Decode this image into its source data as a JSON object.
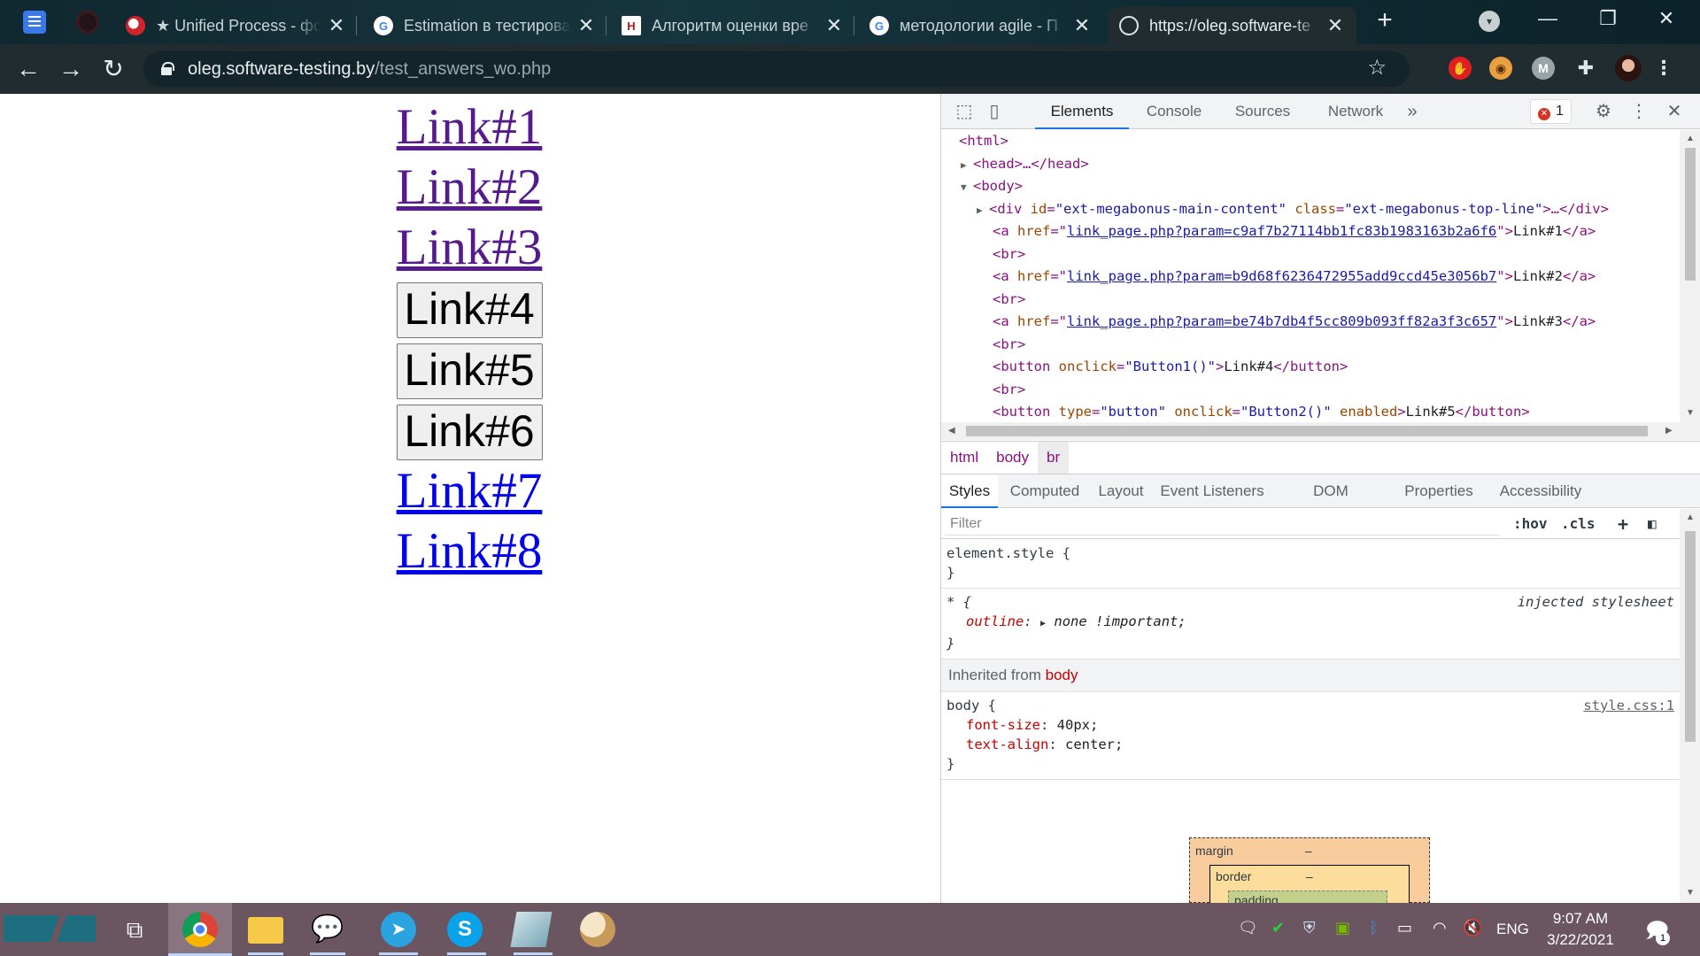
{
  "browser": {
    "tabs": [
      {
        "title": "",
        "active": false
      },
      {
        "title": "★ Unified Process - фо",
        "active": false
      },
      {
        "title": "Estimation в тестирова",
        "active": false
      },
      {
        "title": "Алгоритм оценки вре",
        "active": false
      },
      {
        "title": "методологии agile - П",
        "active": false
      },
      {
        "title": "https://oleg.software-te",
        "active": true
      }
    ],
    "url_host": "oleg.software-testing.by",
    "url_path": "/test_answers_wo.php",
    "profile_initial": "M"
  },
  "page": {
    "links": [
      {
        "label": "Link#1",
        "kind": "link",
        "visited": true
      },
      {
        "label": "Link#2",
        "kind": "link",
        "visited": true
      },
      {
        "label": "Link#3",
        "kind": "link",
        "visited": true
      },
      {
        "label": "Link#4",
        "kind": "button"
      },
      {
        "label": "Link#5",
        "kind": "button"
      },
      {
        "label": "Link#6",
        "kind": "button"
      },
      {
        "label": "Link#7",
        "kind": "link",
        "visited": false
      },
      {
        "label": "Link#8",
        "kind": "link",
        "visited": false
      }
    ]
  },
  "devtools": {
    "tabs": [
      "Elements",
      "Console",
      "Sources",
      "Network"
    ],
    "active_tab": "Elements",
    "error_count": "1",
    "dom": {
      "html_open": "<html>",
      "head": "<head>…</head>",
      "body_open": "<body>",
      "div_tag": "<div",
      "div_id_attr": "id",
      "div_id_val": "\"ext-megabonus-main-content\"",
      "div_class_attr": "class",
      "div_class_val": "\"ext-megabonus-top-line\"",
      "div_close": ">…</div>",
      "links": [
        {
          "href": "link_page.php?param=c9af7b27114bb1fc83b1983163b2a6f6",
          "text": "Link#1"
        },
        {
          "href": "link_page.php?param=b9d68f6236472955add9ccd45e3056b7",
          "text": "Link#2"
        },
        {
          "href": "link_page.php?param=be74b7db4f5cc809b093ff82a3f3c657",
          "text": "Link#3"
        }
      ],
      "br": "<br>",
      "button_onclick": "\"Button1()\"",
      "button_text": "Link#4",
      "button2_type": "\"button\"",
      "button2_onclick": "\"Button2()\"",
      "button2_extra": "enabled",
      "button2_text": "Link#5"
    },
    "breadcrumbs": [
      "html",
      "body",
      "br"
    ],
    "style_tabs": [
      "Styles",
      "Computed",
      "Layout",
      "Event Listeners",
      "DOM Breakpoints",
      "Properties",
      "Accessibility"
    ],
    "filter_placeholder": "Filter",
    "hov": ":hov",
    "cls": ".cls",
    "rules": {
      "element_style": "element.style {",
      "close": "}",
      "star_selector": "* {",
      "star_source": "injected stylesheet",
      "outline_prop": "outline",
      "outline_val": "none !important;",
      "inherited_label": "Inherited from",
      "inherited_tag": "body",
      "body_selector": "body {",
      "body_source": "style.css:1",
      "fs_prop": "font-size",
      "fs_val": "40px;",
      "ta_prop": "text-align",
      "ta_val": "center;"
    },
    "boxmodel": {
      "margin": "margin",
      "border": "border",
      "padding": "padding",
      "dash": "–"
    }
  },
  "taskbar": {
    "lang": "ENG",
    "time": "9:07 AM",
    "date": "3/22/2021",
    "notifications": "1"
  }
}
